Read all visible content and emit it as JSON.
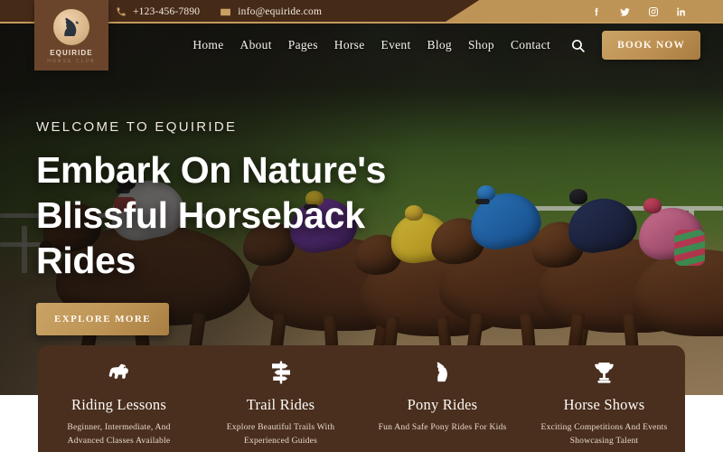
{
  "topbar": {
    "phone": "+123-456-7890",
    "email": "info@equiride.com",
    "phone_icon": "phone-icon",
    "email_icon": "envelope-icon",
    "socials": [
      {
        "name": "facebook-icon",
        "label": "Facebook"
      },
      {
        "name": "twitter-icon",
        "label": "Twitter"
      },
      {
        "name": "instagram-icon",
        "label": "Instagram"
      },
      {
        "name": "linkedin-icon",
        "label": "LinkedIn"
      }
    ]
  },
  "logo": {
    "name": "EQUIRIDE",
    "tagline": "HORSE CLUB",
    "mark": "horse-head-icon"
  },
  "nav": {
    "items": [
      {
        "label": "Home"
      },
      {
        "label": "About"
      },
      {
        "label": "Pages"
      },
      {
        "label": "Horse"
      },
      {
        "label": "Event"
      },
      {
        "label": "Blog"
      },
      {
        "label": "Shop"
      },
      {
        "label": "Contact"
      }
    ],
    "search_icon": "search-icon",
    "cta_label": "BOOK NOW"
  },
  "hero": {
    "eyebrow": "WELCOME TO EQUIRIDE",
    "headline": "Embark On Nature's Blissful Horseback Rides",
    "cta_label": "EXPLORE MORE",
    "background": "horse-race-jockeys-photo"
  },
  "features": [
    {
      "icon": "horse-icon",
      "title": "Riding Lessons",
      "desc": "Beginner, Intermediate, And Advanced Classes Available"
    },
    {
      "icon": "signpost-icon",
      "title": "Trail Rides",
      "desc": "Explore Beautiful Trails With Experienced Guides"
    },
    {
      "icon": "pony-head-icon",
      "title": "Pony Rides",
      "desc": "Fun And Safe Pony Rides For Kids"
    },
    {
      "icon": "trophy-icon",
      "title": "Horse Shows",
      "desc": "Exciting Competitions And Events Showcasing Talent"
    }
  ],
  "colors": {
    "brand_brown": "#4a2f1e",
    "topbar_brown": "#452a18",
    "gold": "#bd9456",
    "gold_light": "#c9a366",
    "logo_box": "#6b452b",
    "text_light": "#fdfaf6"
  }
}
